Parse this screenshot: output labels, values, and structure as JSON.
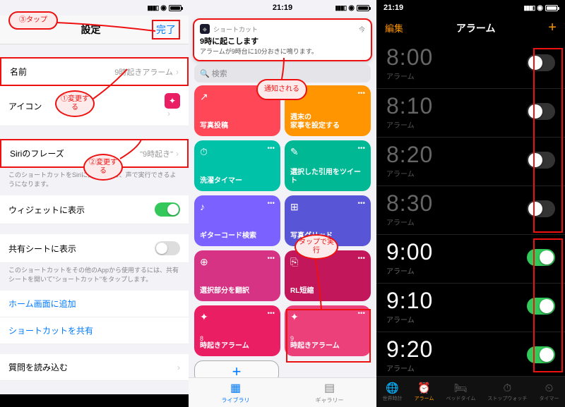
{
  "panel1": {
    "status_time": "",
    "nav": {
      "title": "設定",
      "done": "完了"
    },
    "name_row": {
      "label": "名前",
      "value": "9時起きアラーム"
    },
    "icon_row": {
      "label": "アイコン"
    },
    "siri_row": {
      "label": "Siriのフレーズ",
      "value": "\"9時起き\""
    },
    "siri_help": "このショートカットをSiriに追加すると、声で実行できるようになります。",
    "widget_row": {
      "label": "ウィジェットに表示"
    },
    "share_row": {
      "label": "共有シートに表示"
    },
    "share_help": "このショートカットをその他のAppから使用するには、共有シートを開いて\"ショートカット\"をタップします。",
    "home_row": "ホーム画面に追加",
    "shareshortcut_row": "ショートカットを共有",
    "import_row": "質問を読み込む",
    "callouts": {
      "c1": "①変更する",
      "c2": "②変更する",
      "c3": "③タップ"
    }
  },
  "panel2": {
    "status_time": "21:19",
    "notif": {
      "app": "ショートカット",
      "when": "今",
      "title": "9時に起こします",
      "body": "アラームが9時台に10分おきに鳴ります。"
    },
    "search_placeholder": "検索",
    "tiles": [
      {
        "icon": "↗",
        "label": "写真投稿",
        "color": "#ff4757"
      },
      {
        "icon": "⌂",
        "label": "週末の\n家事を設定する",
        "color": "#ff9500"
      },
      {
        "icon": "⏱",
        "label": "洗濯タイマー",
        "color": "#00c2a8"
      },
      {
        "icon": "✎",
        "label": "選択した引用をツイート",
        "color": "#00b894"
      },
      {
        "icon": "♪",
        "label": "ギターコード検索",
        "color": "#7b61ff"
      },
      {
        "icon": "⊞",
        "label": "写真グリッド",
        "color": "#5856d6"
      },
      {
        "icon": "⊕",
        "label": "選択部分を翻訳",
        "color": "#d63384"
      },
      {
        "icon": "⎘",
        "label": "RL短縮",
        "color": "#c2185b"
      },
      {
        "icon": "✦",
        "num": "8",
        "label": "時起きアラーム",
        "color": "#e91e63"
      },
      {
        "icon": "✦",
        "num": "9",
        "label": "時起きアラーム",
        "color": "#ec407a"
      }
    ],
    "callouts": {
      "c1": "通知される",
      "c2": "タップで実行"
    },
    "tabs": {
      "library": "ライブラリ",
      "gallery": "ギャラリー"
    }
  },
  "panel3": {
    "status_time": "21:19",
    "nav": {
      "edit": "編集",
      "title": "アラーム",
      "add": "+"
    },
    "alarms": [
      {
        "time": "8:00",
        "label": "アラーム",
        "on": false
      },
      {
        "time": "8:10",
        "label": "アラーム",
        "on": false
      },
      {
        "time": "8:20",
        "label": "アラーム",
        "on": false
      },
      {
        "time": "8:30",
        "label": "アラーム",
        "on": false
      },
      {
        "time": "9:00",
        "label": "アラーム",
        "on": true
      },
      {
        "time": "9:10",
        "label": "アラーム",
        "on": true
      },
      {
        "time": "9:20",
        "label": "アラーム",
        "on": true
      }
    ],
    "tabs": [
      "世界時計",
      "アラーム",
      "ベッドタイム",
      "ストップウォッチ",
      "タイマー"
    ],
    "tab_icons": [
      "🌐",
      "⏰",
      "🛏",
      "⏱",
      "⏲"
    ]
  }
}
